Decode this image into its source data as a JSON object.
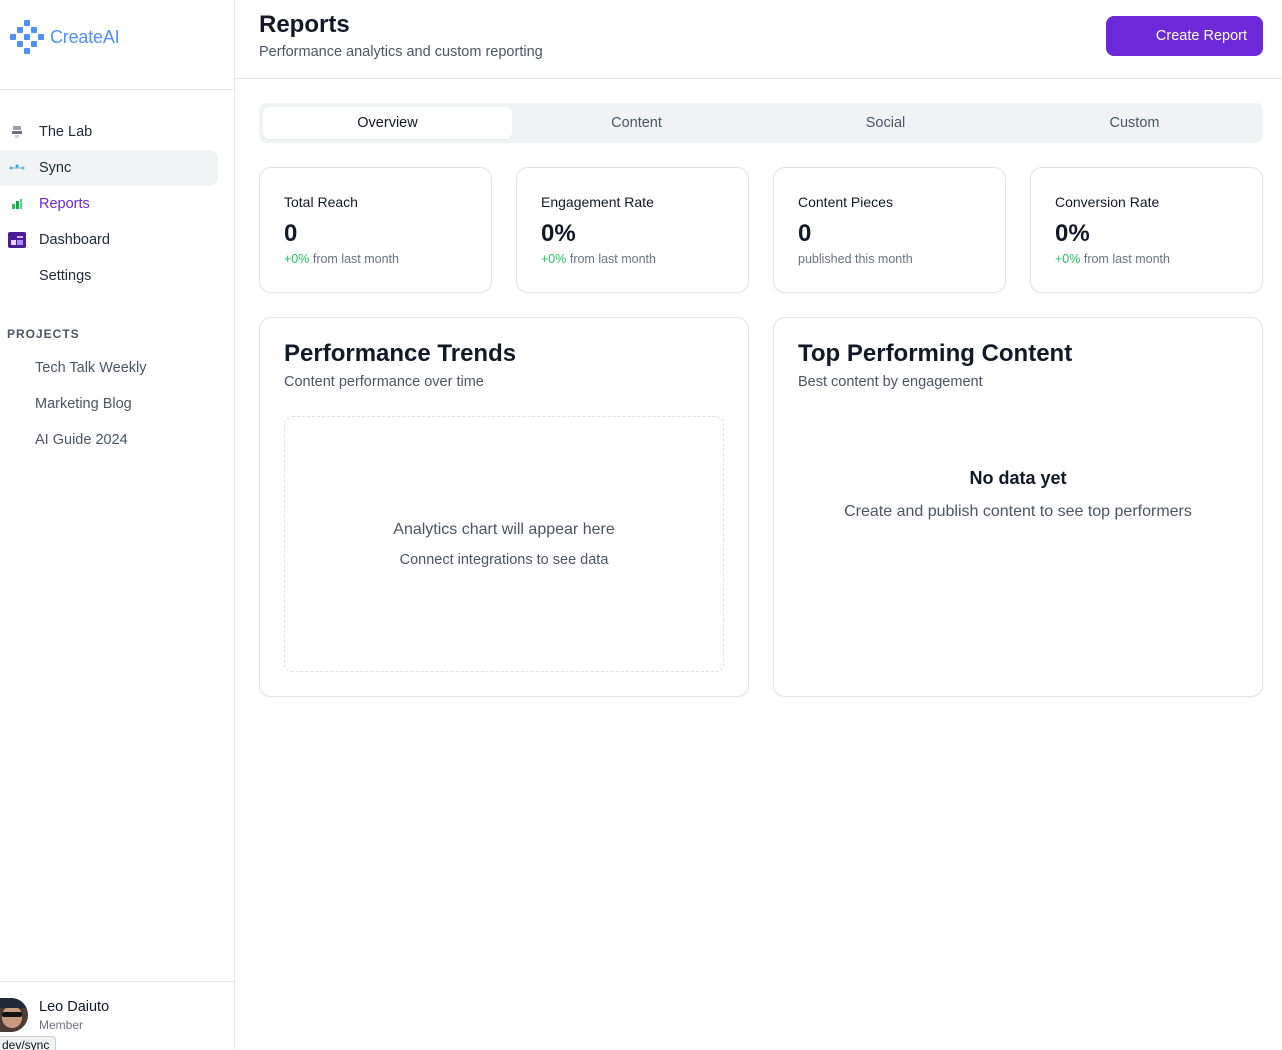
{
  "app": {
    "logo_text": "CreateAI",
    "accent_color": "#6d28d9",
    "logo_color": "#4f8ff7"
  },
  "sidebar": {
    "items": [
      {
        "label": "The Lab",
        "icon": "lab-icon"
      },
      {
        "label": "Sync",
        "icon": "sync-icon",
        "state": "hover"
      },
      {
        "label": "Reports",
        "icon": "reports-icon",
        "state": "active"
      },
      {
        "label": "Dashboard",
        "icon": "dashboard-icon"
      },
      {
        "label": "Settings",
        "icon": ""
      }
    ],
    "projects_title": "PROJECTS",
    "projects": [
      "Tech Talk Weekly",
      "Marketing Blog",
      "AI Guide 2024"
    ],
    "user": {
      "name": "Leo Daiuto",
      "role": "Member"
    },
    "status_url": "dev/sync"
  },
  "header": {
    "title": "Reports",
    "subtitle": "Performance analytics and custom reporting",
    "create_button": "Create Report"
  },
  "tabs": [
    {
      "label": "Overview",
      "selected": true
    },
    {
      "label": "Content"
    },
    {
      "label": "Social"
    },
    {
      "label": "Custom"
    }
  ],
  "stats": [
    {
      "label": "Total Reach",
      "value": "0",
      "delta": "+0%",
      "note": " from last month"
    },
    {
      "label": "Engagement Rate",
      "value": "0%",
      "delta": "+0%",
      "note": " from last month"
    },
    {
      "label": "Content Pieces",
      "value": "0",
      "delta": "",
      "note": "published this month"
    },
    {
      "label": "Conversion Rate",
      "value": "0%",
      "delta": "+0%",
      "note": " from last month"
    }
  ],
  "trends": {
    "title": "Performance Trends",
    "subtitle": "Content performance over time",
    "placeholder_main": "Analytics chart will appear here",
    "placeholder_sub": "Connect integrations to see data"
  },
  "top_content": {
    "title": "Top Performing Content",
    "subtitle": "Best content by engagement",
    "empty_title": "No data yet",
    "empty_sub": "Create and publish content to see top performers"
  }
}
